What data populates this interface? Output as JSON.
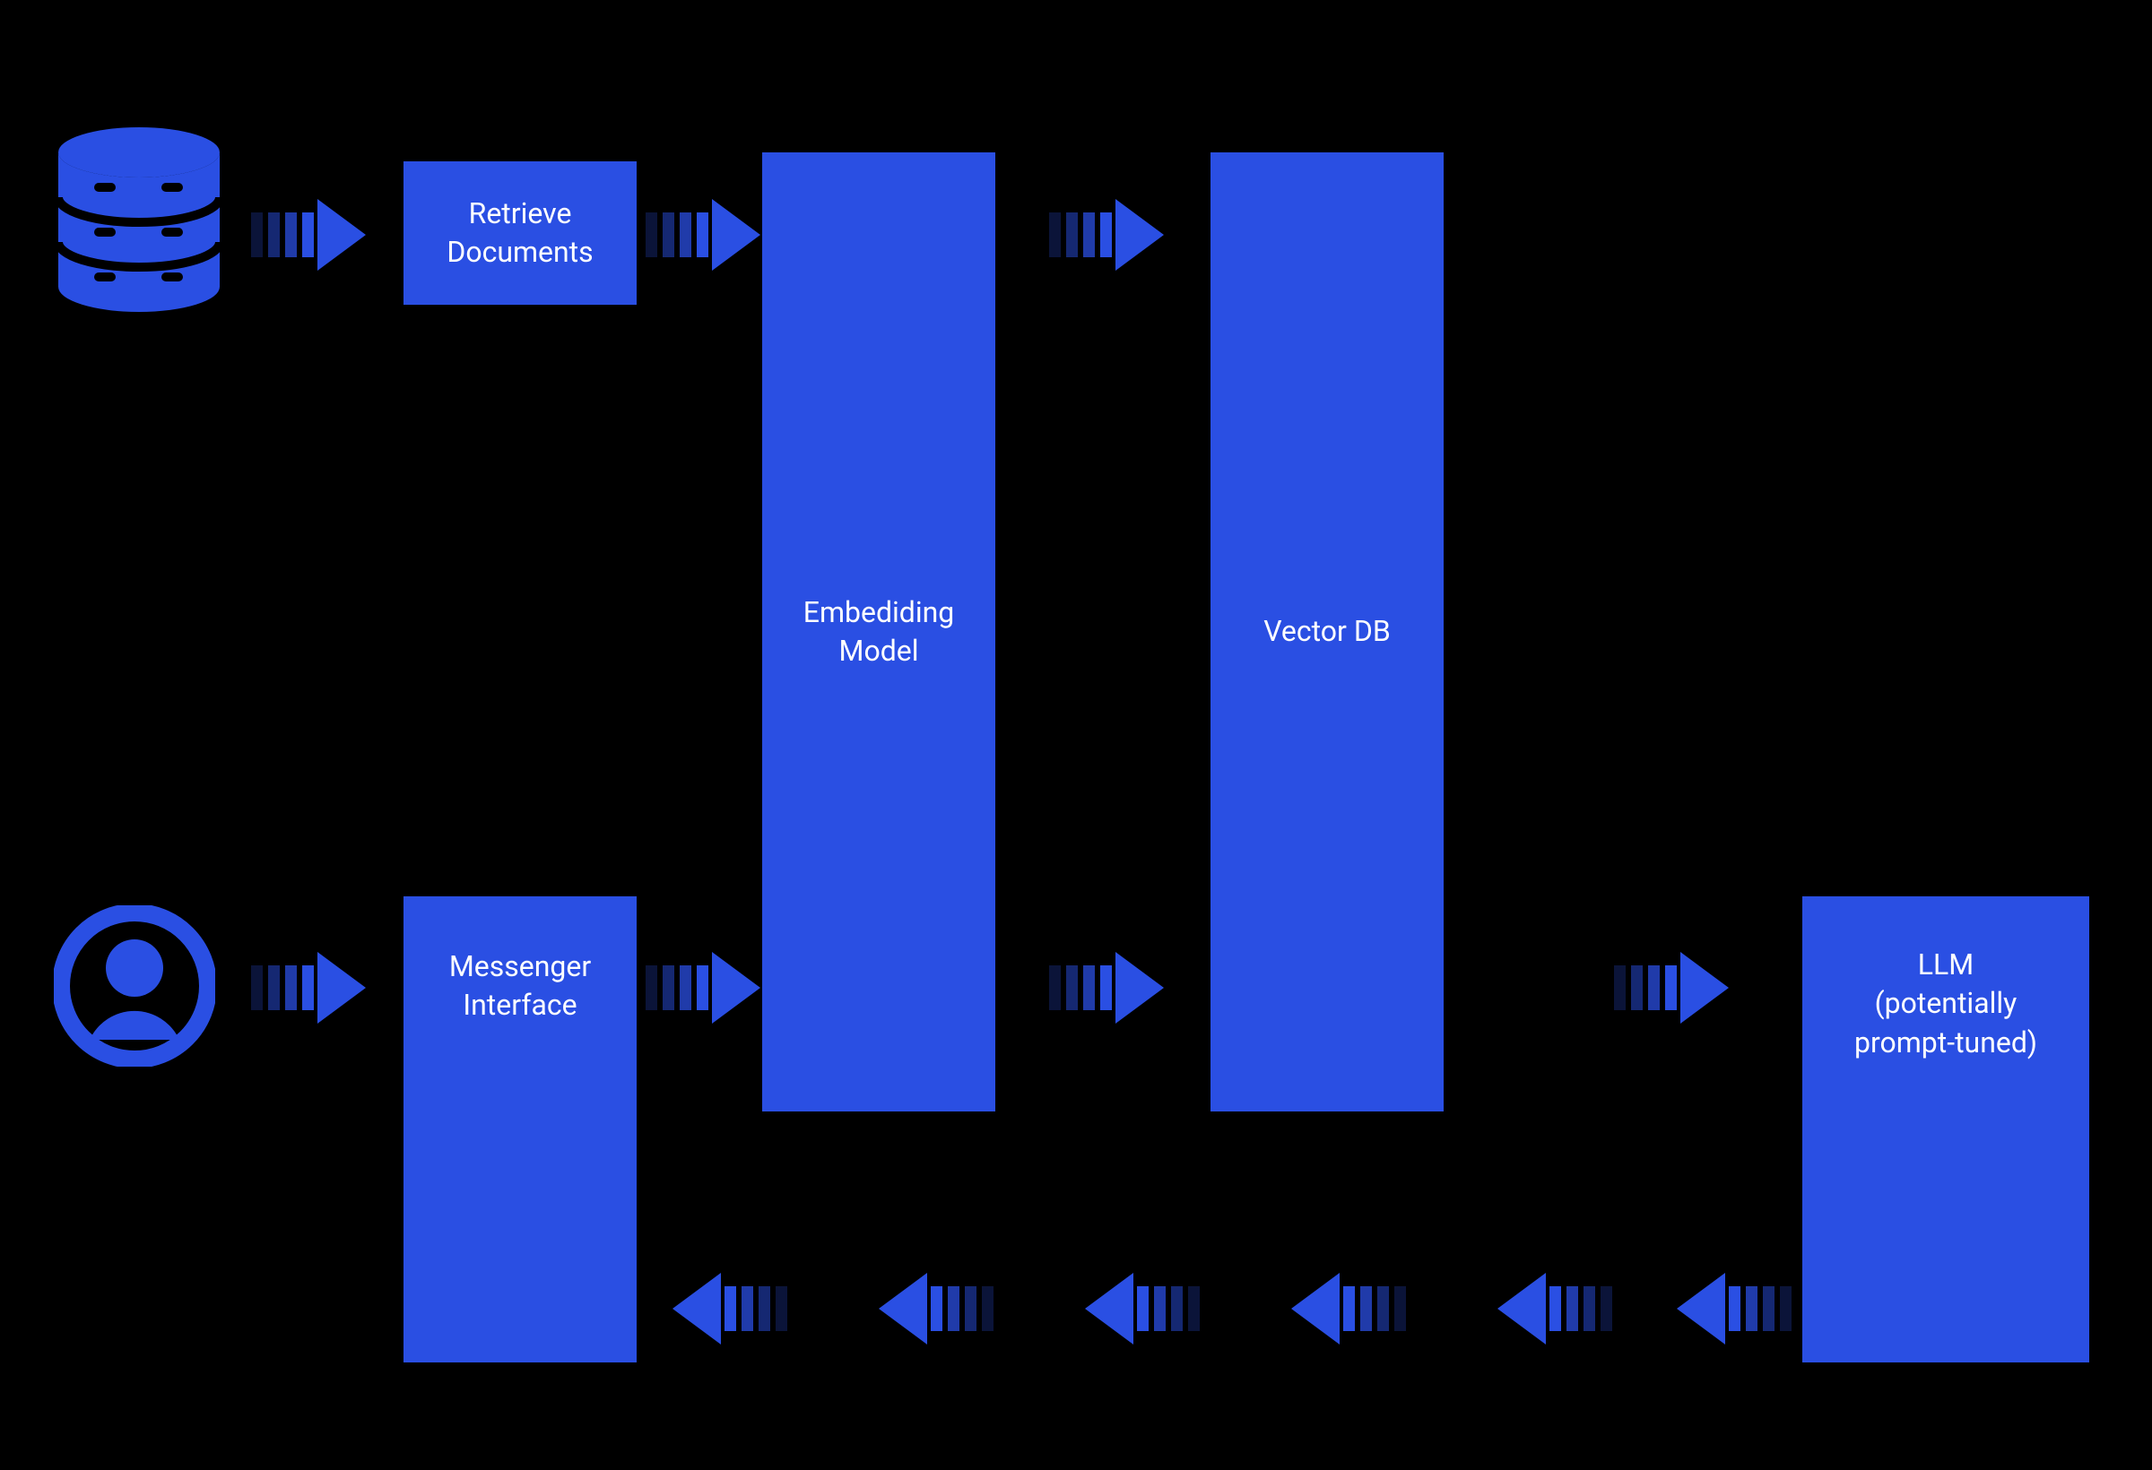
{
  "colors": {
    "accent": "#2A4FE3",
    "bg": "#000000",
    "text": "#FFFFFF"
  },
  "nodes": {
    "retrieve": {
      "line1": "Retrieve",
      "line2": "Documents"
    },
    "embedding": {
      "line1": "Embediding",
      "line2": "Model"
    },
    "vectordb": {
      "line1": "Vector DB"
    },
    "messenger": {
      "line1": "Messenger",
      "line2": "Interface"
    },
    "llm": {
      "line1": "LLM",
      "line2": "(potentially",
      "line3": "prompt-tuned)"
    }
  },
  "icons": {
    "database": "database-icon",
    "user": "user-icon"
  },
  "diagram": {
    "description": "RAG / retrieval-augmented pipeline flow",
    "flows": [
      [
        "database",
        "retrieve",
        "embedding",
        "vectordb"
      ],
      [
        "user",
        "messenger",
        "embedding",
        "vectordb",
        "llm"
      ],
      [
        "llm",
        "messenger"
      ]
    ]
  }
}
